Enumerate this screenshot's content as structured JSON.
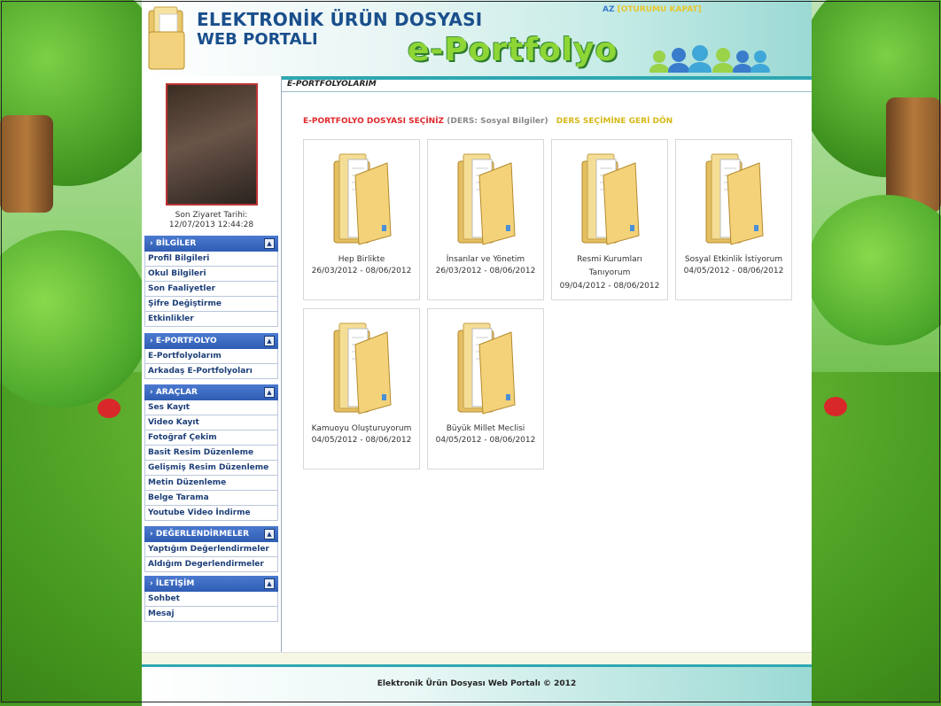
{
  "header": {
    "title_line1": "ELEKTRONİK ÜRÜN DOSYASI",
    "title_line2": "WEB PORTALI",
    "brand": "e-Portfolyo",
    "user_tail": "AZ",
    "logout_label": "[OTURUMU KAPAT]"
  },
  "sidebar": {
    "visit_label": "Son Ziyaret Tarihi:",
    "visit_value": "12/07/2013 12:44:28",
    "sections": [
      {
        "title": "BİLGİLER",
        "items": [
          "Profil Bilgileri",
          "Okul Bilgileri",
          "Son Faaliyetler",
          "Şifre Değiştirme",
          "Etkinlikler"
        ]
      },
      {
        "title": "E-PORTFOLYO",
        "items": [
          "E-Portfolyolarım",
          "Arkadaş E-Portfolyoları"
        ]
      },
      {
        "title": "ARAÇLAR",
        "items": [
          "Ses Kayıt",
          "Video Kayıt",
          "Fotoğraf Çekim",
          "Basit Resim Düzenleme",
          "Gelişmiş Resim Düzenleme",
          "Metin Düzenleme",
          "Belge Tarama",
          "Youtube Video İndirme"
        ]
      },
      {
        "title": "DEĞERLENDİRMELER",
        "items": [
          "Yaptığım Değerlendirmeler",
          "Aldığım Degerlendirmeler"
        ]
      },
      {
        "title": "İLETİŞİM",
        "items": [
          "Sohbet",
          "Mesaj"
        ]
      }
    ]
  },
  "main": {
    "breadcrumb": "E-PORTFOLYOLARIM",
    "select_label": "E-PORTFOLYO DOSYASI SEÇİNİZ",
    "course_label": "(DERS: Sosyal Bilgiler)",
    "back_label": "DERS SEÇİMİNE GERİ DÖN",
    "folders": [
      {
        "name": "Hep Birlikte",
        "dates": "26/03/2012 - 08/06/2012"
      },
      {
        "name": "İnsanlar ve Yönetim",
        "dates": "26/03/2012 - 08/06/2012"
      },
      {
        "name": "Resmi Kurumları Tanıyorum",
        "dates": "09/04/2012 - 08/06/2012"
      },
      {
        "name": "Sosyal Etkinlik İstiyorum",
        "dates": "04/05/2012 - 08/06/2012"
      },
      {
        "name": "Kamuoyu Oluşturuyorum",
        "dates": "04/05/2012 - 08/06/2012"
      },
      {
        "name": "Büyük Millet Meclisi",
        "dates": "04/05/2012 - 08/06/2012"
      }
    ]
  },
  "footer": {
    "copyright": "Elektronik Ürün Dosyası Web Portalı © 2012"
  },
  "colors": {
    "header_blue": "#1a4f8c",
    "brand_green": "#8ed636",
    "section_blue": "#2f5db4",
    "select_red": "#e0282c",
    "back_yellow": "#d6b818"
  }
}
